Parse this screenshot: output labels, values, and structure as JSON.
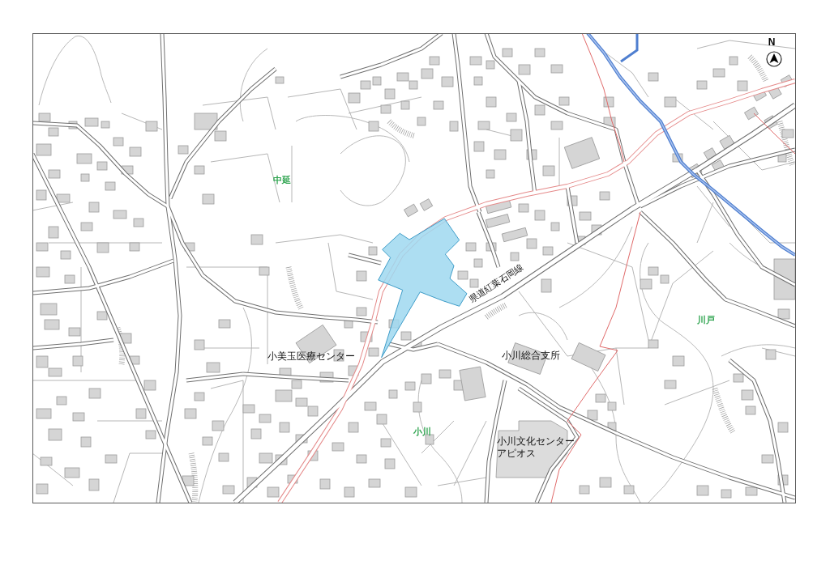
{
  "map": {
    "north_arrow": {
      "label": "N"
    },
    "area_names": [
      "中延",
      "川戸",
      "小川"
    ],
    "facility_names": [
      {
        "lines": [
          "小美玉医療センター"
        ]
      },
      {
        "lines": [
          "小川総合支所"
        ]
      },
      {
        "lines": [
          "小川文化センター",
          "アピオス"
        ]
      }
    ],
    "road_name": "県道紅葉石岡線"
  }
}
